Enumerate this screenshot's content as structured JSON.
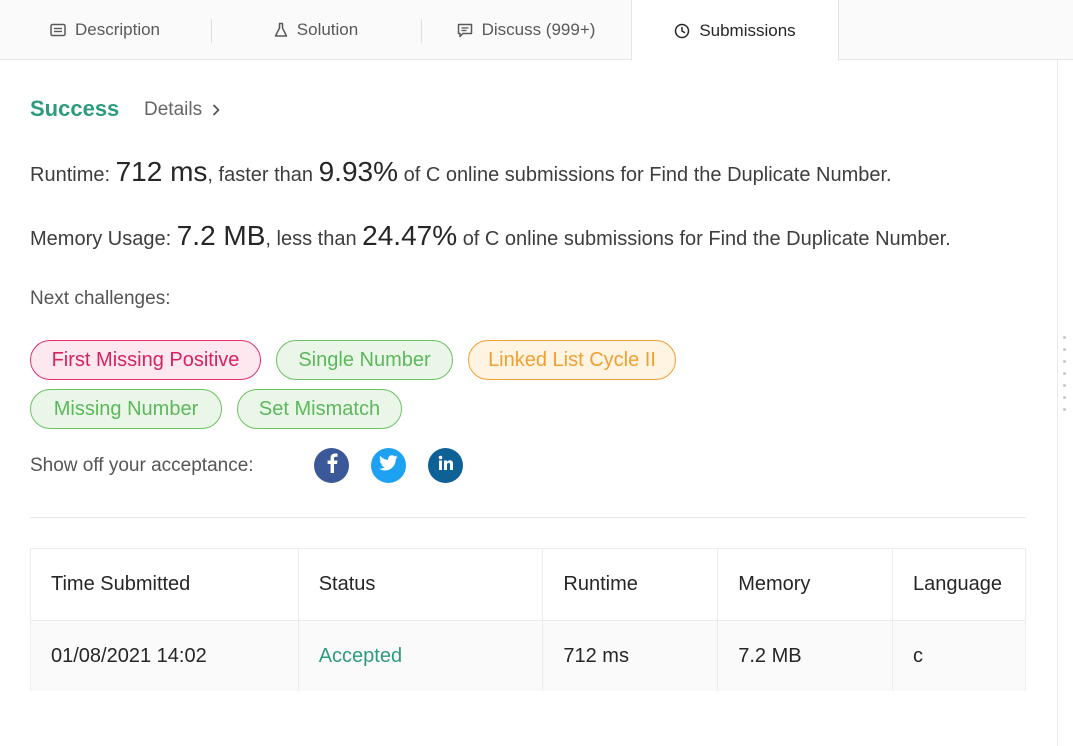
{
  "tabs": [
    {
      "label": "Description",
      "icon": "description-icon"
    },
    {
      "label": "Solution",
      "icon": "flask-icon"
    },
    {
      "label": "Discuss (999+)",
      "icon": "comment-icon"
    },
    {
      "label": "Submissions",
      "icon": "clock-icon",
      "active": true
    }
  ],
  "result": {
    "status": "Success",
    "details_label": "Details"
  },
  "runtime": {
    "label": "Runtime:",
    "value": "712 ms",
    "comparison": ", faster than",
    "percent": "9.93%",
    "suffix": "of C online submissions for Find the Duplicate Number."
  },
  "memory": {
    "label": "Memory Usage:",
    "value": "7.2 MB",
    "comparison": ", less than",
    "percent": "24.47%",
    "suffix": "of C online submissions for Find the Duplicate Number."
  },
  "next_challenges": {
    "label": "Next challenges:",
    "items": [
      {
        "label": "First Missing Positive",
        "difficulty": "hard"
      },
      {
        "label": "Single Number",
        "difficulty": "easy"
      },
      {
        "label": "Linked List Cycle II",
        "difficulty": "medium"
      },
      {
        "label": "Missing Number",
        "difficulty": "easy"
      },
      {
        "label": "Set Mismatch",
        "difficulty": "easy"
      }
    ]
  },
  "share": {
    "label": "Show off your acceptance:",
    "buttons": [
      {
        "icon": "facebook-icon",
        "color": "#3b5998"
      },
      {
        "icon": "twitter-icon",
        "color": "#1da1f2"
      },
      {
        "icon": "linkedin-icon",
        "color": "#0e6196"
      }
    ]
  },
  "submissions_table": {
    "headers": [
      "Time Submitted",
      "Status",
      "Runtime",
      "Memory",
      "Language"
    ],
    "rows": [
      [
        "01/08/2021 14:02",
        "Accepted",
        "712 ms",
        "7.2 MB",
        "c"
      ]
    ]
  },
  "colors": {
    "success": "#2e9b7e",
    "hard": "#d5235f",
    "easy": "#5cb85c",
    "medium": "#f0a030"
  }
}
